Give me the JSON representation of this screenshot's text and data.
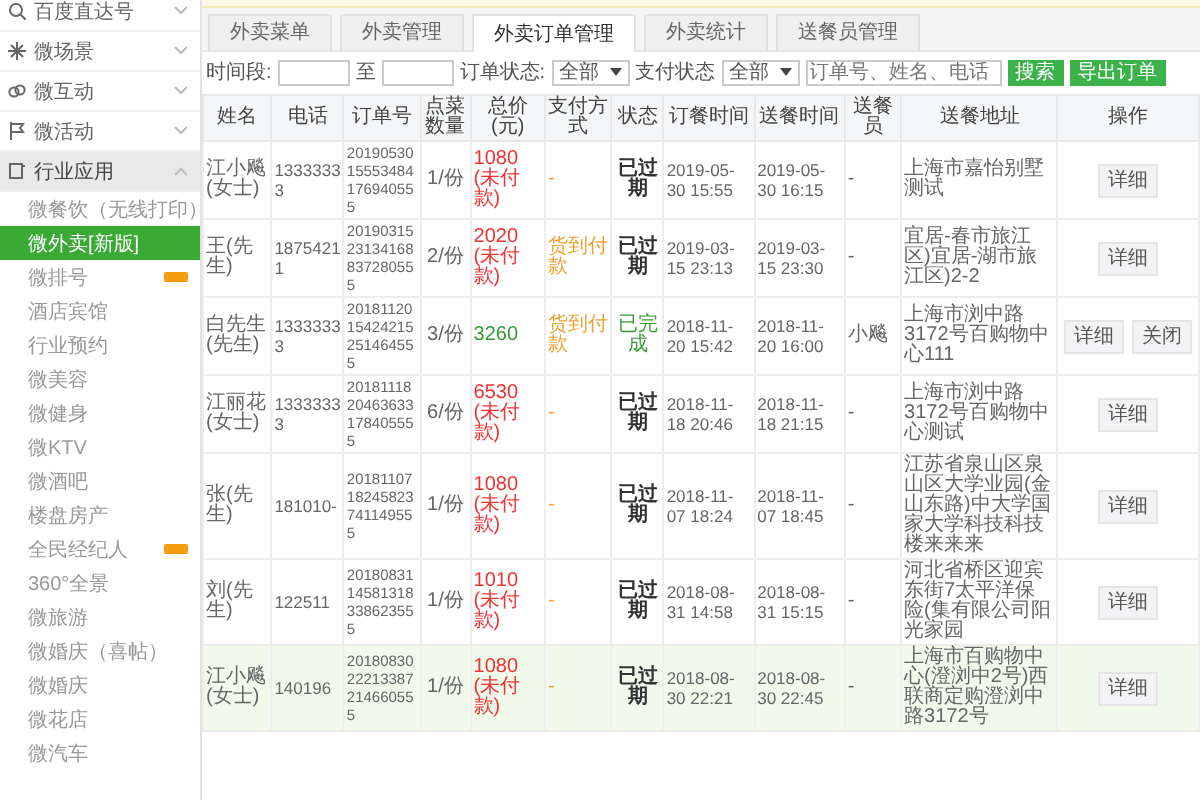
{
  "sidebar": {
    "items": [
      {
        "label": "百度直达号",
        "expanded": false
      },
      {
        "label": "微场景",
        "expanded": false
      },
      {
        "label": "微互动",
        "expanded": false
      },
      {
        "label": "微活动",
        "expanded": false
      },
      {
        "label": "行业应用",
        "expanded": true,
        "children": [
          {
            "label": "微餐饮（无线打印）",
            "selected": false,
            "badge": false
          },
          {
            "label": "微外卖[新版]",
            "selected": true,
            "badge": false
          },
          {
            "label": "微排号",
            "selected": false,
            "badge": true
          },
          {
            "label": "酒店宾馆",
            "selected": false,
            "badge": false
          },
          {
            "label": "行业预约",
            "selected": false,
            "badge": false
          },
          {
            "label": "微美容",
            "selected": false,
            "badge": false
          },
          {
            "label": "微健身",
            "selected": false,
            "badge": false
          },
          {
            "label": "微KTV",
            "selected": false,
            "badge": false
          },
          {
            "label": "微酒吧",
            "selected": false,
            "badge": false
          },
          {
            "label": "楼盘房产",
            "selected": false,
            "badge": false
          },
          {
            "label": "全民经纪人",
            "selected": false,
            "badge": true
          },
          {
            "label": "360°全景",
            "selected": false,
            "badge": false
          },
          {
            "label": "微旅游",
            "selected": false,
            "badge": false
          },
          {
            "label": "微婚庆（喜帖）",
            "selected": false,
            "badge": false
          },
          {
            "label": "微婚庆",
            "selected": false,
            "badge": false
          },
          {
            "label": "微花店",
            "selected": false,
            "badge": false
          },
          {
            "label": "微汽车",
            "selected": false,
            "badge": false
          }
        ]
      }
    ]
  },
  "tabs": [
    {
      "label": "外卖菜单",
      "selected": false
    },
    {
      "label": "外卖管理",
      "selected": false
    },
    {
      "label": "外卖订单管理",
      "selected": true
    },
    {
      "label": "外卖统计",
      "selected": false
    },
    {
      "label": "送餐员管理",
      "selected": false
    }
  ],
  "filters": {
    "period_label": "时间段:",
    "to_label": "至",
    "order_status": {
      "label": "订单状态:",
      "value": "全部"
    },
    "pay_status": {
      "label": "支付状态",
      "value": "全部"
    },
    "search": {
      "placeholder": "订单号、姓名、电话"
    },
    "buttons": [
      "搜索",
      "导出订单"
    ]
  },
  "table": {
    "columns": [
      "姓名",
      "电话",
      "订单号",
      "点菜数量",
      "总价(元)",
      "支付方式",
      "状态",
      "订餐时间",
      "送餐时间",
      "送餐员",
      "送餐地址",
      "操作"
    ],
    "rows": [
      {
        "name": "江小飚(女士)",
        "phone": "13333333",
        "order_no": "2019053015553484176940555",
        "qty": "1/份",
        "price": "1080 (未付款)",
        "paid": false,
        "payment": "-",
        "status": "已过期",
        "completed": false,
        "order_time": "2019-05-30 15:55",
        "delivery_time": "2019-05-30 16:15",
        "courier": "-",
        "address": "上海市嘉怡别墅测试",
        "actions": [
          "详细"
        ],
        "highlighted": false
      },
      {
        "name": "王(先生)",
        "phone": "18754211",
        "order_no": "2019031523134168837280555",
        "qty": "2/份",
        "price": "2020 (未付款)",
        "paid": false,
        "payment": "货到付款",
        "status": "已过期",
        "completed": false,
        "order_time": "2019-03-15 23:13",
        "delivery_time": "2019-03-15 23:30",
        "courier": "-",
        "address": "宜居-春市旅江区)宜居-湖市旅江区)2-2",
        "actions": [
          "详细"
        ],
        "highlighted": false
      },
      {
        "name": "白先生(先生)",
        "phone": "13333333",
        "order_no": "2018112015424215251464555",
        "qty": "3/份",
        "price": "3260",
        "paid": true,
        "payment": "货到付款",
        "status": "已完成",
        "completed": true,
        "order_time": "2018-11-20 15:42",
        "delivery_time": "2018-11-20 16:00",
        "courier": "小飚",
        "address": "上海市浏中路3172号百购物中心111",
        "actions": [
          "详细",
          "关闭"
        ],
        "highlighted": false
      },
      {
        "name": "江丽花(女士)",
        "phone": "13333333",
        "order_no": "2018111820463633178405555",
        "qty": "6/份",
        "price": "6530 (未付款)",
        "paid": false,
        "payment": "-",
        "status": "已过期",
        "completed": false,
        "order_time": "2018-11-18 20:46",
        "delivery_time": "2018-11-18 21:15",
        "courier": "-",
        "address": "上海市浏中路3172号百购物中心测试",
        "actions": [
          "详细"
        ],
        "highlighted": false
      },
      {
        "name": "张(先生)",
        "phone": "181010-",
        "order_no": "2018110718245823741149555",
        "qty": "1/份",
        "price": "1080 (未付款)",
        "paid": false,
        "payment": "-",
        "status": "已过期",
        "completed": false,
        "order_time": "2018-11-07 18:24",
        "delivery_time": "2018-11-07 18:45",
        "courier": "-",
        "address": "江苏省泉山区泉山区大学业园(金山东路)中大学国家大学科技科技楼来来来",
        "actions": [
          "详细"
        ],
        "highlighted": false
      },
      {
        "name": "刘(先生)",
        "phone": "122511",
        "order_no": "2018083114581318338623555",
        "qty": "1/份",
        "price": "1010 (未付款)",
        "paid": false,
        "payment": "-",
        "status": "已过期",
        "completed": false,
        "order_time": "2018-08-31 14:58",
        "delivery_time": "2018-08-31 15:15",
        "courier": "-",
        "address": "河北省桥区迎宾东街7太平洋保险(集有限公司阳光家园",
        "actions": [
          "详细"
        ],
        "highlighted": false
      },
      {
        "name": "江小飚(女士)",
        "phone": "140196",
        "order_no": "2018083022213387214660555",
        "qty": "1/份",
        "price": "1080 (未付款)",
        "paid": false,
        "payment": "-",
        "status": "已过期",
        "completed": false,
        "order_time": "2018-08-30 22:21",
        "delivery_time": "2018-08-30 22:45",
        "courier": "-",
        "address": "上海市百购物中心(澄浏中2号)西联商定购澄浏中路3172号",
        "actions": [
          "详细"
        ],
        "highlighted": true
      }
    ]
  }
}
